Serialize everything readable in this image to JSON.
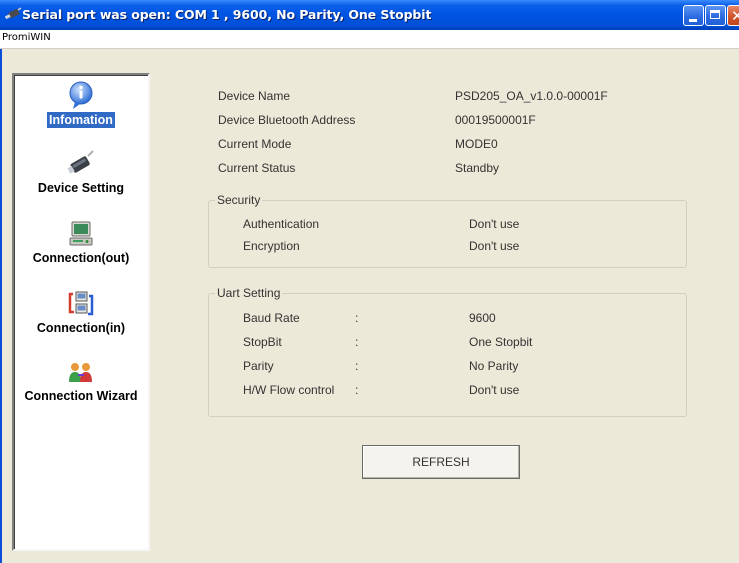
{
  "window": {
    "title": "Serial port was open: COM 1 , 9600, No Parity, One Stopbit",
    "menu_label": "PromiWIN"
  },
  "sidebar": {
    "items": [
      {
        "label": "Infomation",
        "icon": "info-icon",
        "selected": true
      },
      {
        "label": "Device Setting",
        "icon": "device-icon",
        "selected": false
      },
      {
        "label": "Connection(out)",
        "icon": "computer-connection-out-icon",
        "selected": false
      },
      {
        "label": "Connection(in)",
        "icon": "computer-connection-in-icon",
        "selected": false
      },
      {
        "label": "Connection Wizard",
        "icon": "wizard-people-icon",
        "selected": false
      }
    ]
  },
  "info": {
    "device_name_label": "Device Name",
    "device_name_value": "PSD205_OA_v1.0.0-00001F",
    "bt_address_label": "Device Bluetooth Address",
    "bt_address_value": "00019500001F",
    "mode_label": "Current Mode",
    "mode_value": "MODE0",
    "status_label": "Current Status",
    "status_value": "Standby"
  },
  "security": {
    "title": "Security",
    "auth_label": "Authentication",
    "auth_value": "Don't use",
    "enc_label": "Encryption",
    "enc_value": "Don't use"
  },
  "uart": {
    "title": "Uart Setting",
    "colon": ":",
    "baud_label": "Baud Rate",
    "baud_value": "9600",
    "stopbit_label": "StopBit",
    "stopbit_value": "One Stopbit",
    "parity_label": "Parity",
    "parity_value": "No Parity",
    "flow_label": "H/W Flow control",
    "flow_value": "Don't use"
  },
  "buttons": {
    "refresh_label": "REFRESH"
  },
  "colors": {
    "title_bar": "#0054e3",
    "selected_bg": "#316ac5",
    "window_bg": "#ece9d8"
  }
}
